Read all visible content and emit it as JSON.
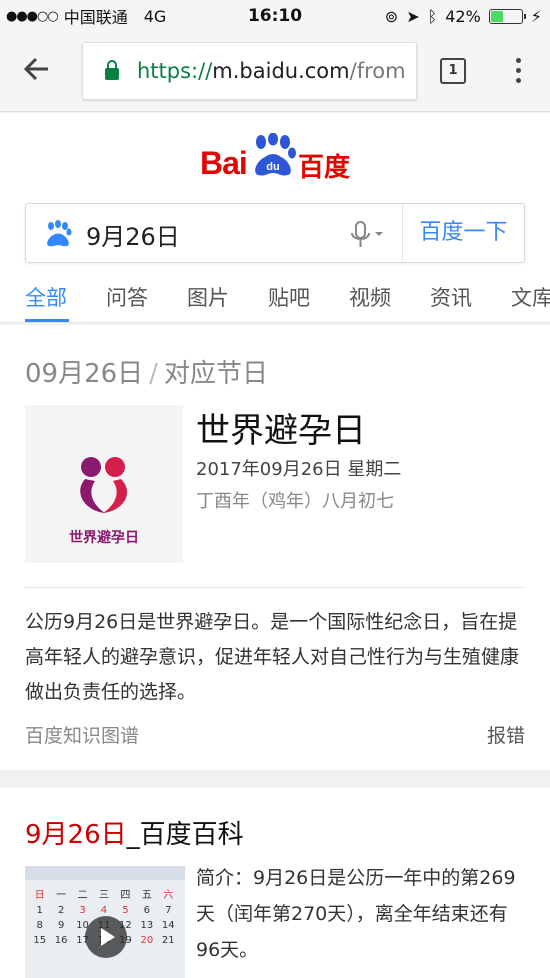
{
  "status_bar": {
    "carrier": "中国联通",
    "network": "4G",
    "time": "16:10",
    "battery_percent": "42%",
    "battery_level": 0.42
  },
  "browser": {
    "url_scheme": "https://",
    "url_host": "m.baidu.com",
    "url_rest": "/from",
    "tab_count": "1"
  },
  "baidu": {
    "logo_latin": "Bai",
    "logo_paw_text": "du",
    "logo_cn": "百度",
    "query": "9月26日",
    "search_button": "百度一下",
    "tabs": [
      "全部",
      "问答",
      "图片",
      "贴吧",
      "视频",
      "资讯",
      "文库"
    ]
  },
  "result_festival": {
    "date_label": "09月26日",
    "separator": "/",
    "category": "对应节日",
    "logo_text": "世界避孕日",
    "name": "世界避孕日",
    "date": "2017年09月26日 星期二",
    "lunar": "丁酉年（鸡年）八月初七",
    "description": "公历9月26日是世界避孕日。是一个国际性纪念日，旨在提高年轻人的避孕意识，促进年轻人对自己性行为与生殖健康做出负责任的选择。",
    "source": "百度知识图谱",
    "report": "报错"
  },
  "result_baike": {
    "title_highlight": "9月26日",
    "title_rest": "_百度百科",
    "intro": "简介：9月26日是公历一年中的第269天（闰年第270天），离全年结束还有96天。",
    "thumb_weekdays": [
      "日",
      "一",
      "二",
      "三",
      "四",
      "五",
      "六"
    ],
    "thumb_days": [
      "1",
      "2",
      "3",
      "4",
      "5",
      "6",
      "7",
      "8",
      "9",
      "10",
      "11",
      "12",
      "13",
      "14",
      "15",
      "16",
      "17",
      "18",
      "19",
      "20",
      "21"
    ]
  },
  "colors": {
    "baidu_red": "#e10601",
    "baidu_blue": "#3388ff",
    "secure_green": "#0b8043",
    "highlight_red": "#cc0000"
  }
}
